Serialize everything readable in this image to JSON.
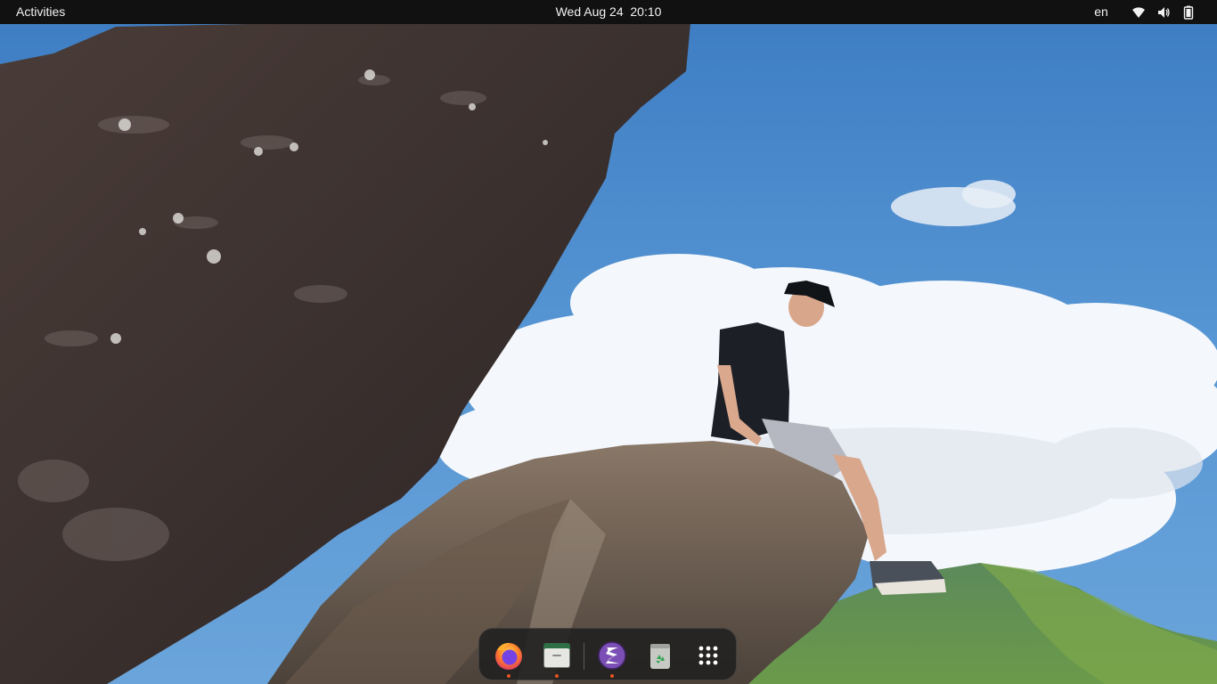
{
  "topbar": {
    "activities_label": "Activities",
    "clock_text": "Wed Aug 24  20:10",
    "language": "en",
    "icons": [
      "wifi-icon",
      "volume-icon",
      "battery-icon"
    ]
  },
  "dock": {
    "apps": [
      {
        "name": "Firefox",
        "icon": "firefox-icon",
        "running": true
      },
      {
        "name": "Files",
        "icon": "files-icon",
        "running": true
      },
      {
        "name": "Emacs",
        "icon": "emacs-icon",
        "running": true
      },
      {
        "name": "Trash",
        "icon": "trash-icon",
        "running": false
      },
      {
        "name": "Show Applications",
        "icon": "app-grid-icon",
        "running": false
      }
    ]
  },
  "colors": {
    "topbar_bg": "#111111",
    "accent": "#e95420",
    "sky": "#4f8fd0"
  }
}
